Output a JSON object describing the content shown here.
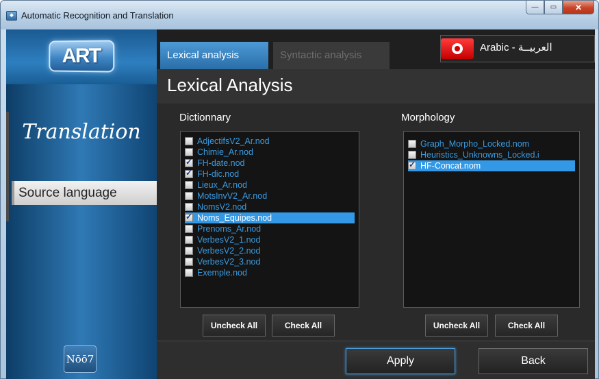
{
  "window": {
    "title": "Automatic Recognition and Translation",
    "controls": {
      "minimize": "—",
      "maximize": "▭",
      "close": "✕"
    }
  },
  "sidebar": {
    "logo_text": "ART",
    "section_title": "Translation",
    "active_item": "Source language",
    "badge_text": "Nōō7"
  },
  "tabs": [
    {
      "label": "Lexical analysis",
      "active": true
    },
    {
      "label": "Syntactic analysis",
      "active": false
    }
  ],
  "language": {
    "label": "Arabic - العربيــة",
    "flag": "tunisia-flag"
  },
  "panel": {
    "title": "Lexical Analysis"
  },
  "dictionary": {
    "label": "Dictionnary",
    "items": [
      {
        "label": "AdjectifsV2_Ar.nod",
        "checked": false,
        "selected": false
      },
      {
        "label": "Chimie_Ar.nod",
        "checked": false,
        "selected": false
      },
      {
        "label": "FH-date.nod",
        "checked": true,
        "selected": false
      },
      {
        "label": "FH-dic.nod",
        "checked": true,
        "selected": false
      },
      {
        "label": "Lieux_Ar.nod",
        "checked": false,
        "selected": false
      },
      {
        "label": "MotsInvV2_Ar.nod",
        "checked": false,
        "selected": false
      },
      {
        "label": "NomsV2.nod",
        "checked": false,
        "selected": false
      },
      {
        "label": "Noms_Equipes.nod",
        "checked": true,
        "selected": true
      },
      {
        "label": "Prenoms_Ar.nod",
        "checked": false,
        "selected": false
      },
      {
        "label": "VerbesV2_1.nod",
        "checked": false,
        "selected": false
      },
      {
        "label": "VerbesV2_2.nod",
        "checked": false,
        "selected": false
      },
      {
        "label": "VerbesV2_3.nod",
        "checked": false,
        "selected": false
      },
      {
        "label": " Exemple.nod",
        "checked": false,
        "selected": false
      }
    ],
    "uncheck_all": "Uncheck All",
    "check_all": "Check All"
  },
  "morphology": {
    "label": "Morphology",
    "items": [
      {
        "label": "Graph_Morpho_Locked.nom",
        "checked": false,
        "selected": false
      },
      {
        "label": "Heuristics_Unknowns_Locked.i",
        "checked": false,
        "selected": false
      },
      {
        "label": "HF-Concat.nom",
        "checked": true,
        "selected": true
      }
    ],
    "uncheck_all": "Uncheck All",
    "check_all": "Check All"
  },
  "footer": {
    "apply": "Apply",
    "back": "Back"
  },
  "colors": {
    "accent": "#3399e6",
    "item_text": "#3a9be0",
    "background": "#2a2a2a"
  }
}
